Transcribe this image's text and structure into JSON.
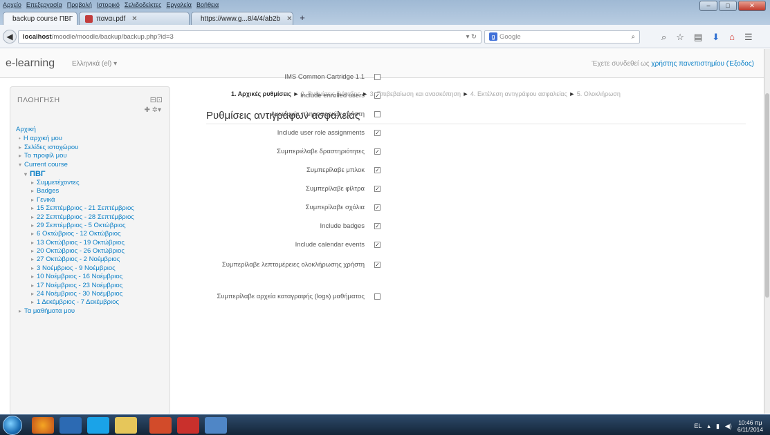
{
  "browser": {
    "menu": [
      "Αρχείο",
      "Επεξεργασία",
      "Προβολή",
      "Ιστορικό",
      "Σελιδοδείκτες",
      "Εργαλεία",
      "Βοήθεια"
    ],
    "tabs": [
      {
        "label": "backup course ΠΒΓ"
      },
      {
        "label": "παναι.pdf"
      },
      {
        "label": "https://www.g...8/4/4/ab2b"
      }
    ],
    "new_tab": "+",
    "url_host": "localhost",
    "url_path": "/moodle/moodle/backup/backup.php?id=3",
    "search_placeholder": "Google"
  },
  "header": {
    "brand": "e-learning",
    "language": "Ελληνικά (el) ▾",
    "login_text": "Έχετε συνδεθεί ως ",
    "login_user": "χρήστης πανεπιστημίου",
    "logout": "(Έξοδος)"
  },
  "navigation": {
    "title": "ΠΛΟΗΓΗΣΗ",
    "items": [
      {
        "label": "Αρχική",
        "arrow": ""
      },
      {
        "label": "Η αρχική μου",
        "arrow": "•"
      },
      {
        "label": "Σελίδες ιστοχώρου",
        "arrow": "▸"
      },
      {
        "label": "Το προφίλ μου",
        "arrow": "▸"
      },
      {
        "label": "Current course",
        "arrow": "▾"
      },
      {
        "label": "ΠΒΓ",
        "arrow": "▾"
      },
      {
        "label": "Συμμετέχοντες",
        "arrow": "▸"
      },
      {
        "label": "Badges",
        "arrow": "▸"
      },
      {
        "label": "Γενικά",
        "arrow": "▸"
      },
      {
        "label": "15 Σεπτέμβριος - 21 Σεπτέμβριος",
        "arrow": "▸"
      },
      {
        "label": "22 Σεπτέμβριος - 28 Σεπτέμβριος",
        "arrow": "▸"
      },
      {
        "label": "29 Σεπτέμβριος - 5 Οκτώβριος",
        "arrow": "▸"
      },
      {
        "label": "6 Οκτώβριος - 12 Οκτώβριος",
        "arrow": "▸"
      },
      {
        "label": "13 Οκτώβριος - 19 Οκτώβριος",
        "arrow": "▸"
      },
      {
        "label": "20 Οκτώβριος - 26 Οκτώβριος",
        "arrow": "▸"
      },
      {
        "label": "27 Οκτώβριος - 2 Νοέμβριος",
        "arrow": "▸"
      },
      {
        "label": "3 Νοέμβριος - 9 Νοέμβριος",
        "arrow": "▸"
      },
      {
        "label": "10 Νοέμβριος - 16 Νοέμβριος",
        "arrow": "▸"
      },
      {
        "label": "17 Νοέμβριος - 23 Νοέμβριος",
        "arrow": "▸"
      },
      {
        "label": "24 Νοέμβριος - 30 Νοέμβριος",
        "arrow": "▸"
      },
      {
        "label": "1 Δεκέμβριος - 7 Δεκέμβριος",
        "arrow": "▸"
      },
      {
        "label": "Τα μαθήματα μου",
        "arrow": "▸"
      }
    ]
  },
  "content": {
    "steps": [
      "1. Αρχικές ρυθμίσεις",
      "2. Ρυθμίσεις διάταξης",
      "3. Επιβεβαίωση και ανασκόπηση",
      "4. Εκτέλεση αντιγράφου ασφαλείας",
      "5. Ολοκλήρωση"
    ],
    "step_sep": " ► ",
    "title": "Ρυθμίσεις αντιγράφων ασφαλείας",
    "settings": [
      {
        "label": "IMS Common Cartridge 1.1",
        "checked": false
      },
      {
        "label": "Include enrolled users",
        "checked": true
      },
      {
        "label": "Ανωνυμία πληροφοριών χρήστη",
        "checked": false
      },
      {
        "label": "Include user role assignments",
        "checked": true
      },
      {
        "label": "Συμπεριέλαβε δραστηριότητες",
        "checked": true
      },
      {
        "label": "Συμπερίλαβε μπλοκ",
        "checked": true
      },
      {
        "label": "Συμπερίλαβε φίλτρα",
        "checked": true
      },
      {
        "label": "Συμπερίλαβε σχόλια",
        "checked": true
      },
      {
        "label": "Include badges",
        "checked": true
      },
      {
        "label": "Include calendar events",
        "checked": true
      },
      {
        "label": "Συμπερίλαβε λεπτομέρειες ολοκλήρωσης χρήστη",
        "checked": true
      },
      {
        "label": "Συμπερίλαβε αρχεία καταγραφής (logs) μαθήματος",
        "checked": false
      }
    ],
    "checked_mark": "✓"
  },
  "taskbar": {
    "language": "EL",
    "time": "10:46 πμ",
    "date": "6/11/2014"
  }
}
